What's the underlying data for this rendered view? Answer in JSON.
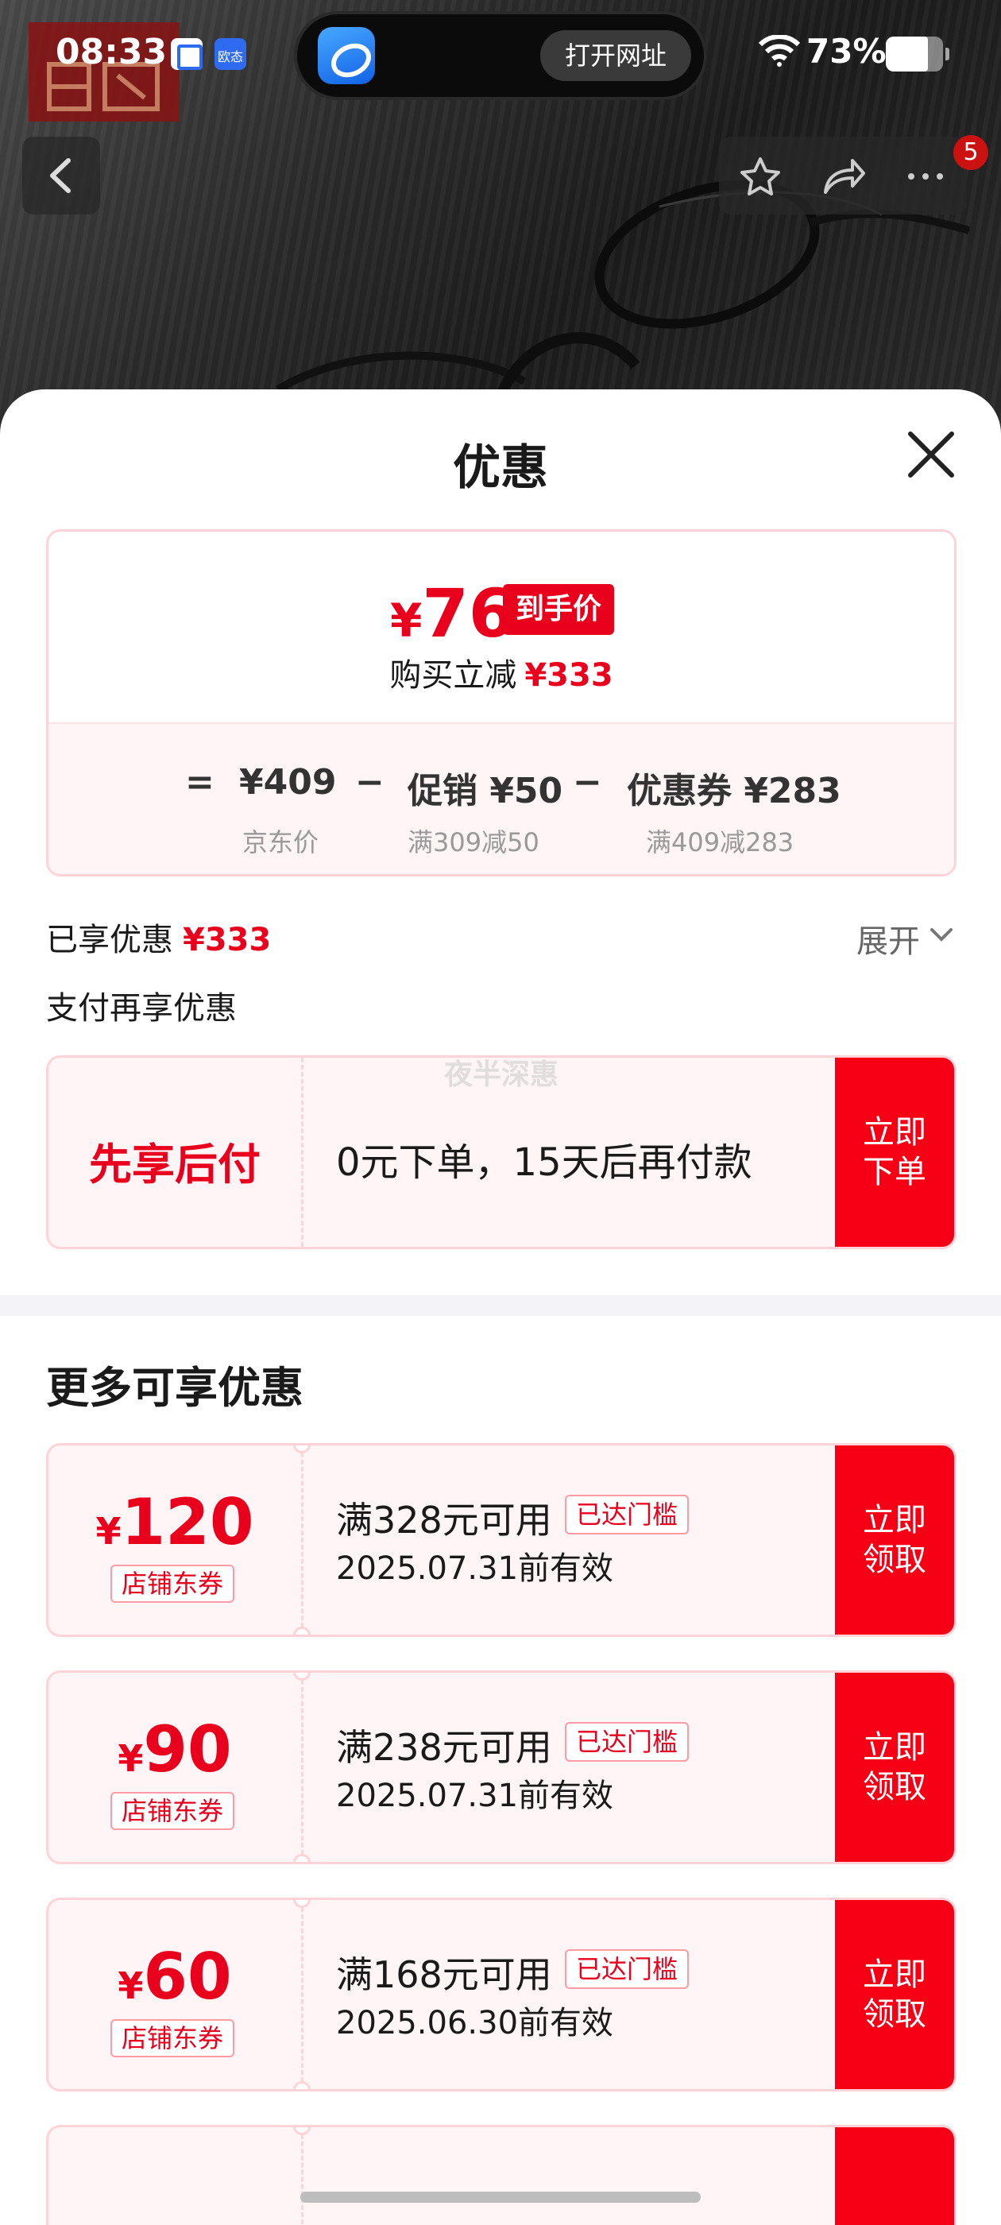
{
  "status_bar": {
    "time": "08:33",
    "app_icon_2_label": "欧态",
    "island_button": "打开网址",
    "battery_percent": "73%",
    "battery_level": 0.73
  },
  "nav": {
    "badge_count": "5"
  },
  "sheet": {
    "title": "优惠"
  },
  "price_summary": {
    "currency": "¥",
    "final_price": "76",
    "final_tag": "到手价",
    "instant_cut_label": "购买立减",
    "instant_cut_amount": "¥333",
    "equals": "=",
    "jd_price": "¥409",
    "jd_price_label": "京东价",
    "minus": "−",
    "promo": "促销 ¥50",
    "promo_rule": "满309减50",
    "coupon": "优惠券 ¥283",
    "coupon_rule": "满409减283"
  },
  "enjoyed": {
    "label": "已享优惠",
    "amount": "¥333",
    "expand_label": "展开"
  },
  "pay_more": {
    "title": "支付再享优惠",
    "bnpl": {
      "name": "先享后付",
      "desc": "0元下单，15天后再付款",
      "cta": "立即下单",
      "watermark": "夜半深惠"
    }
  },
  "more": {
    "title": "更多可享优惠",
    "coupons": [
      {
        "currency": "¥",
        "amount": "120",
        "type": "店铺东券",
        "condition": "满328元可用",
        "badge": "已达门槛",
        "valid": "2025.07.31前有效",
        "cta": "立即领取"
      },
      {
        "currency": "¥",
        "amount": "90",
        "type": "店铺东券",
        "condition": "满238元可用",
        "badge": "已达门槛",
        "valid": "2025.07.31前有效",
        "cta": "立即领取"
      },
      {
        "currency": "¥",
        "amount": "60",
        "type": "店铺东券",
        "condition": "满168元可用",
        "badge": "已达门槛",
        "valid": "2025.06.30前有效",
        "cta": "立即领取"
      }
    ]
  },
  "colors": {
    "accent_red": "#e8001c",
    "cta_red": "#f50015",
    "card_border": "#ffd3d8",
    "card_bg": "#fff5f6"
  }
}
